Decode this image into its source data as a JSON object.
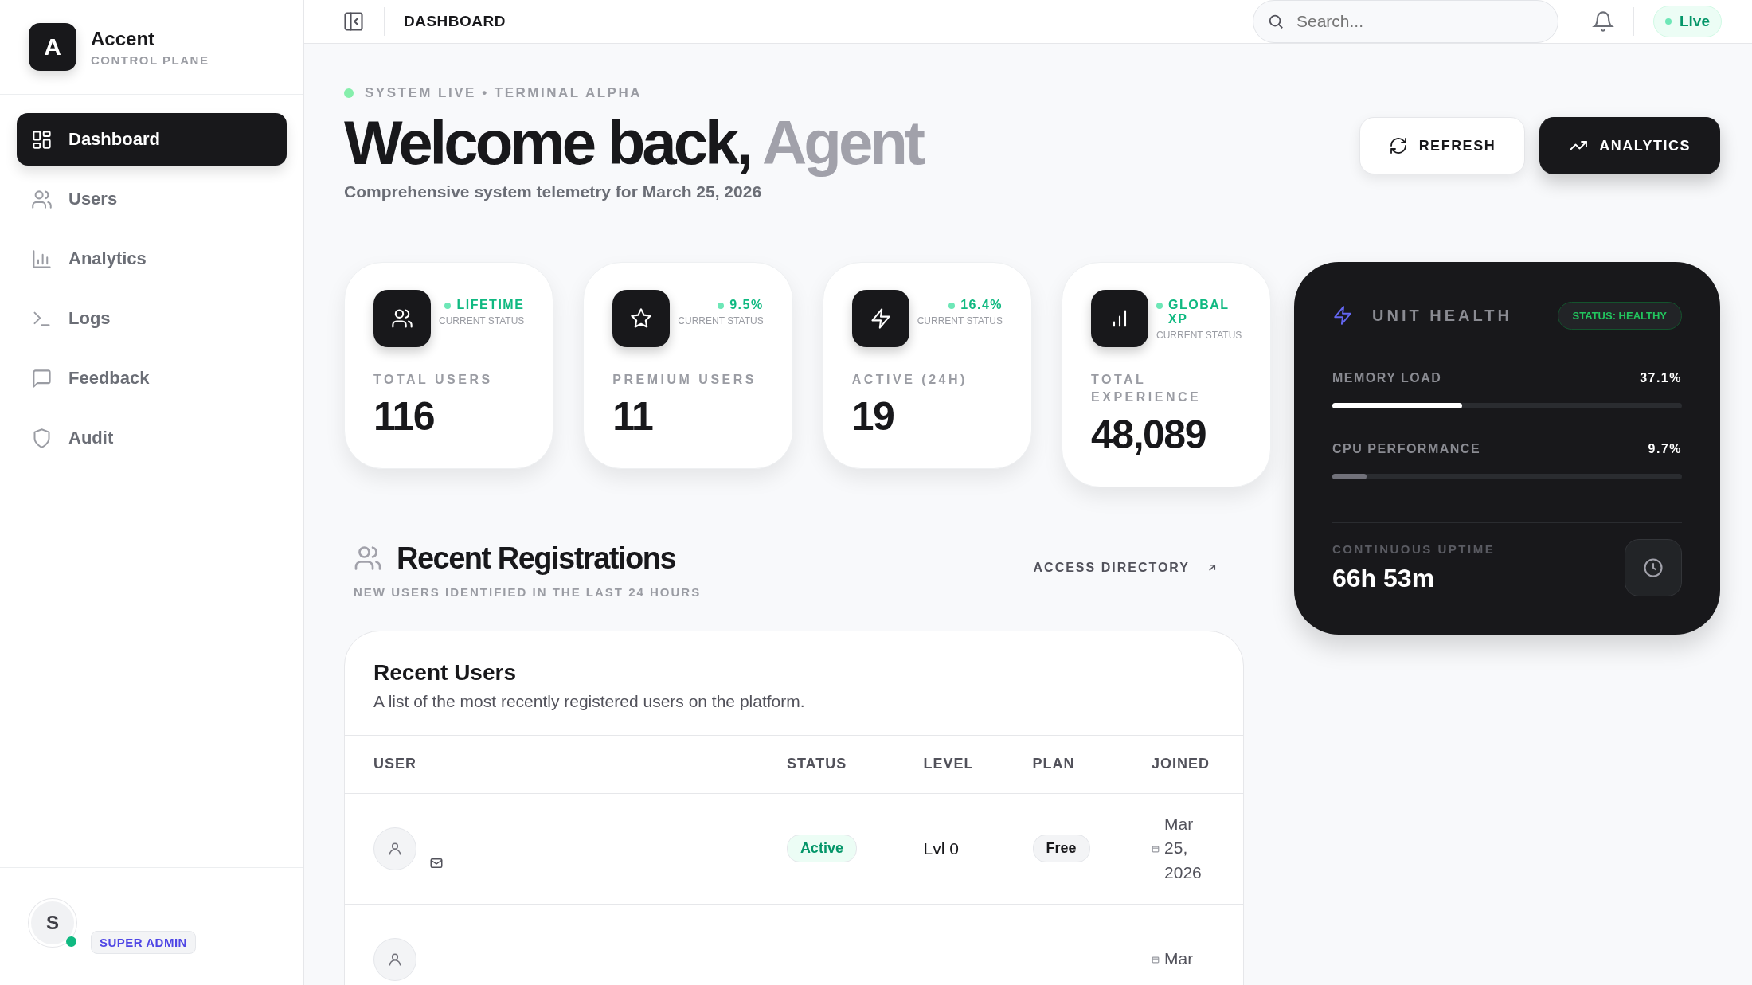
{
  "sidebar": {
    "logo_letter": "A",
    "brand": "Accent",
    "subtitle": "CONTROL PLANE",
    "items": [
      {
        "label": "Dashboard",
        "selected": true
      },
      {
        "label": "Users",
        "selected": false
      },
      {
        "label": "Analytics",
        "selected": false
      },
      {
        "label": "Logs",
        "selected": false
      },
      {
        "label": "Feedback",
        "selected": false
      },
      {
        "label": "Audit",
        "selected": false
      }
    ],
    "user": {
      "initial": "S",
      "online": true,
      "role": "SUPER ADMIN"
    }
  },
  "header": {
    "title": "DASHBOARD",
    "search": {
      "placeholder": "Search..."
    },
    "live": "Live"
  },
  "hero": {
    "eyebrow": "SYSTEM LIVE • TERMINAL ALPHA",
    "title": "Welcome back,",
    "title_accent": "Agent",
    "subtitle": "Comprehensive system telemetry for March 25, 2026",
    "buttons": [
      {
        "label": "REFRESH",
        "kind": "secondary"
      },
      {
        "label": "ANALYTICS",
        "kind": "primary"
      }
    ]
  },
  "stats": [
    {
      "trend": "LIFETIME",
      "status": "CURRENT STATUS",
      "label": "TOTAL USERS",
      "value": "116"
    },
    {
      "trend": "9.5%",
      "status": "CURRENT STATUS",
      "label": "PREMIUM USERS",
      "value": "11"
    },
    {
      "trend": "16.4%",
      "status": "CURRENT STATUS",
      "label": "ACTIVE (24H)",
      "value": "19"
    },
    {
      "trend": "GLOBAL XP",
      "status": "CURRENT STATUS",
      "label": "TOTAL EXPERIENCE",
      "value": "48,089"
    }
  ],
  "health": {
    "title": "UNIT HEALTH",
    "badge": "STATUS: HEALTHY",
    "meters": [
      {
        "label": "MEMORY LOAD",
        "reading": "37.1%",
        "level": 0.371,
        "kind": "primary"
      },
      {
        "label": "CPU PERFORMANCE",
        "reading": "9.7%",
        "level": 0.097,
        "kind": "muted"
      }
    ],
    "uptime_label": "CONTINUOUS UPTIME",
    "uptime": "66h 53m"
  },
  "registrations": {
    "title": "Recent Registrations",
    "subtitle": "NEW USERS IDENTIFIED IN THE LAST 24 HOURS",
    "link": "ACCESS DIRECTORY",
    "table": {
      "title": "Recent Users",
      "description": "A list of the most recently registered users on the platform.",
      "columns": [
        "USER",
        "STATUS",
        "LEVEL",
        "PLAN",
        "JOINED"
      ],
      "rows": [
        {
          "status": "Active",
          "level": "Lvl 0",
          "plan": "Free",
          "joined": "Mar 25, 2026"
        },
        {
          "joined": "Mar"
        }
      ]
    }
  }
}
